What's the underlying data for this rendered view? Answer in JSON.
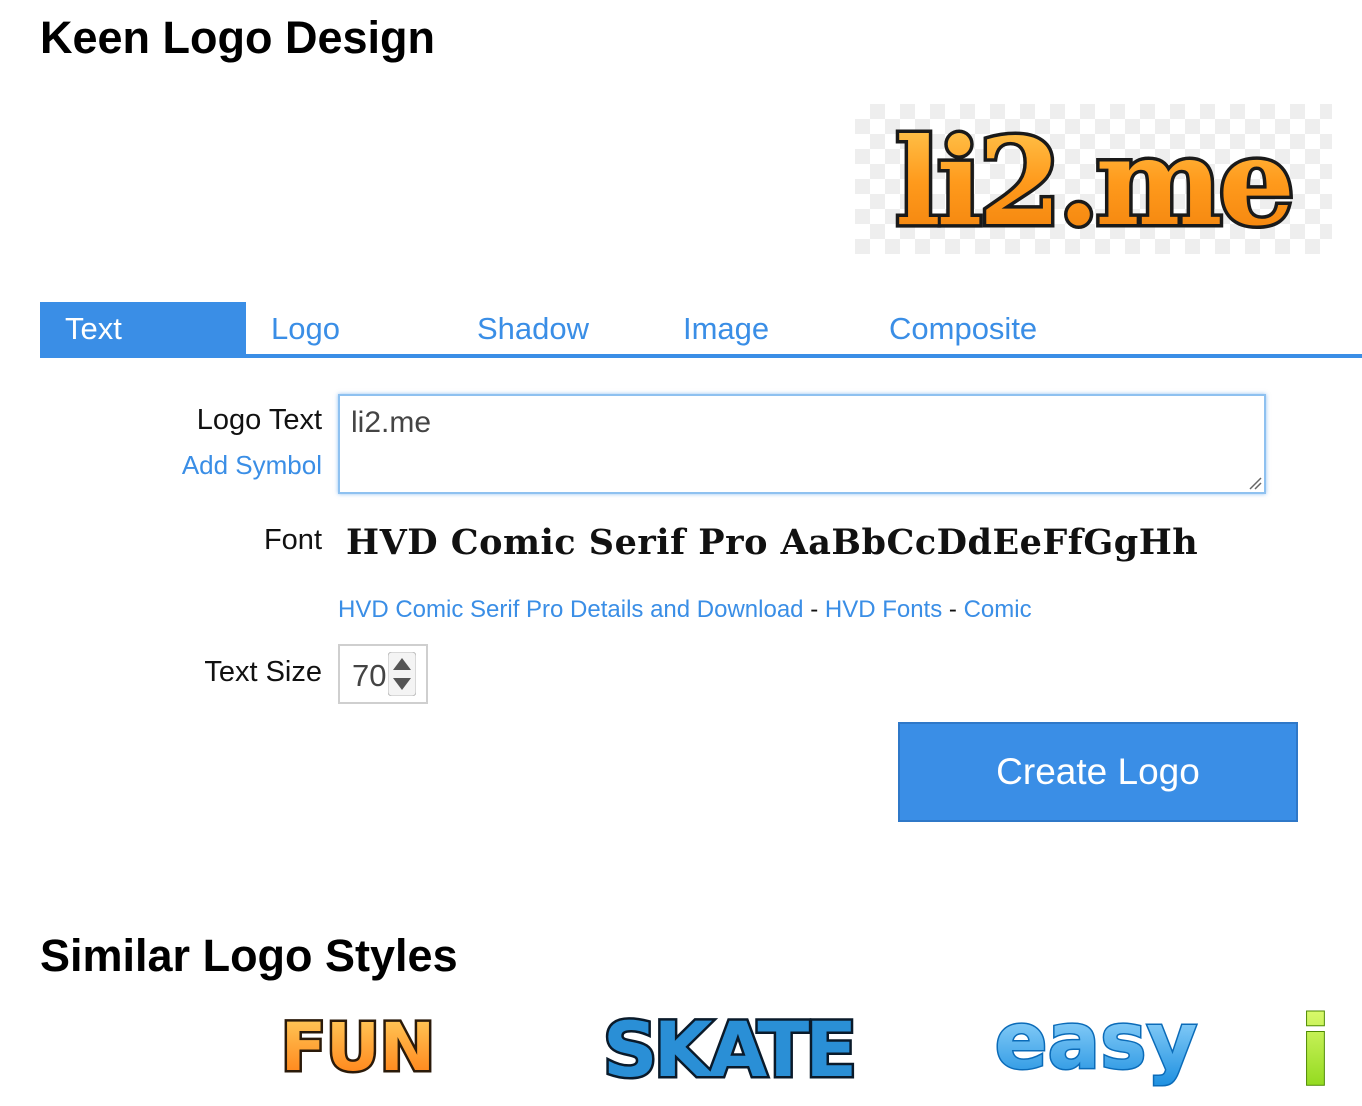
{
  "page": {
    "title": "Keen Logo Design"
  },
  "preview": {
    "logo_text": "li2.me",
    "fill_color": "#ff9a1c",
    "outline_color": "#1a1a1a"
  },
  "tabs": [
    {
      "label": "Text",
      "active": true
    },
    {
      "label": "Logo",
      "active": false
    },
    {
      "label": "Shadow",
      "active": false
    },
    {
      "label": "Image",
      "active": false
    },
    {
      "label": "Composite",
      "active": false
    }
  ],
  "form": {
    "logo_text_label": "Logo Text",
    "add_symbol_link": "Add Symbol",
    "logo_text_value": "li2.me",
    "font_label": "Font",
    "font_sample": "HVD Comic Serif Pro AaBbCcDdEeFfGgHh",
    "font_links": {
      "details": "HVD Comic Serif Pro Details and Download",
      "separator": "-",
      "foundry": "HVD Fonts",
      "category": "Comic"
    },
    "text_size_label": "Text Size",
    "text_size_value": "70",
    "create_button": "Create Logo"
  },
  "similar": {
    "title": "Similar Logo Styles",
    "styles": [
      {
        "text": "FUN",
        "icon": "fun-logo-style",
        "color": "#ff8c1a"
      },
      {
        "text": "SKATE",
        "icon": "skate-logo-style",
        "color": "#2a8fd6"
      },
      {
        "text": "easy",
        "icon": "easy-logo-style",
        "color": "#4fb3f0"
      },
      {
        "text": "i",
        "icon": "partial-logo-style",
        "color": "#9be61e"
      }
    ]
  },
  "colors": {
    "accent": "#3a8ee6",
    "text": "#111111"
  }
}
